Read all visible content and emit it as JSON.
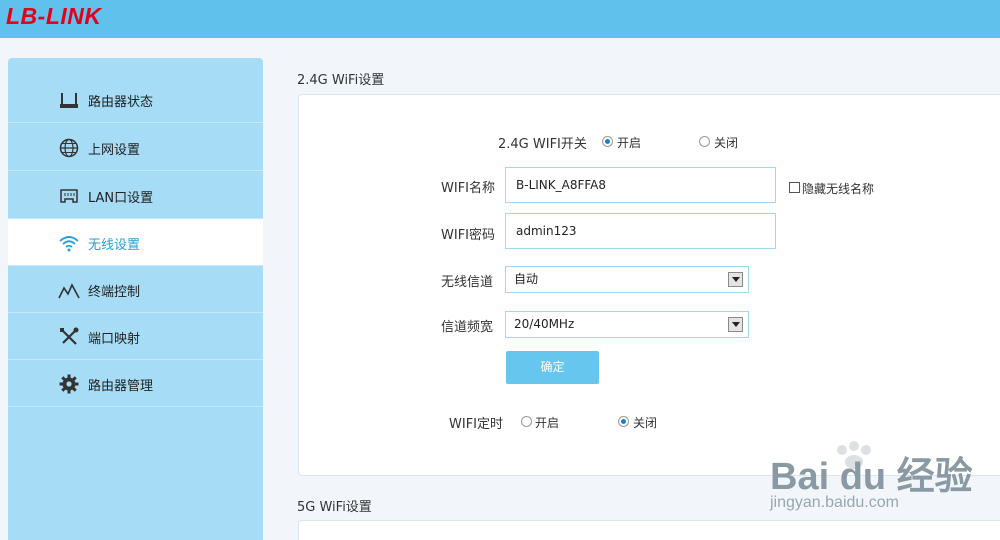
{
  "header": {
    "logo_text": "LB-LINK",
    "bg_color": "#5fc1ec",
    "logo_color": "#e4001b"
  },
  "sidebar": {
    "items": [
      {
        "label": "路由器状态",
        "icon": "router-icon"
      },
      {
        "label": "上网设置",
        "icon": "globe-icon"
      },
      {
        "label": "LAN口设置",
        "icon": "lan-port-icon"
      },
      {
        "label": "无线设置",
        "icon": "wifi-icon",
        "active": true
      },
      {
        "label": "终端控制",
        "icon": "terminal-control-icon"
      },
      {
        "label": "端口映射",
        "icon": "tools-icon"
      },
      {
        "label": "路由器管理",
        "icon": "gear-icon"
      }
    ],
    "active_color": "#2a9fd6"
  },
  "wifi24": {
    "title": "2.4G WiFi设置",
    "switch_label": "2.4G WIFI开关",
    "on_label": "开启",
    "off_label": "关闭",
    "switch_value": "on",
    "name_label": "WIFI名称",
    "name_value": "B-LINK_A8FFA8",
    "hide_ssid_label": "隐藏无线名称",
    "hide_ssid_checked": false,
    "password_label": "WIFI密码",
    "password_value": "admin123",
    "channel_label": "无线信道",
    "channel_value": "自动",
    "bandwidth_label": "信道频宽",
    "bandwidth_value": "20/40MHz",
    "confirm_label": "确定",
    "timer_label": "WIFI定时",
    "timer_on_label": "开启",
    "timer_off_label": "关闭",
    "timer_value": "off"
  },
  "wifi5": {
    "title": "5G WiFi设置"
  },
  "watermark": {
    "brand": "Bai du 经验",
    "url": "jingyan.baidu.com"
  }
}
